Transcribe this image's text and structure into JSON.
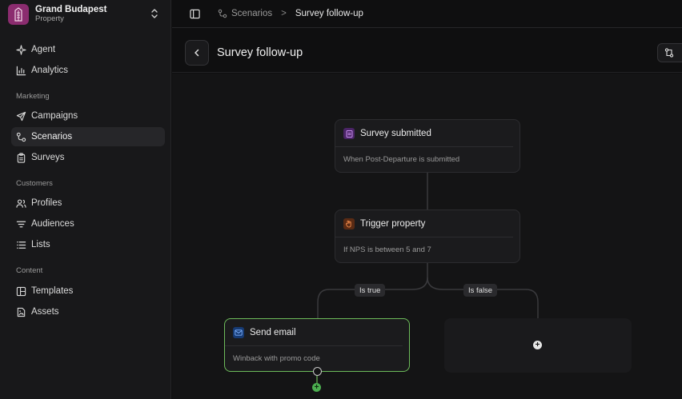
{
  "property": {
    "name": "Grand Budapest",
    "subtitle": "Property"
  },
  "nav": {
    "items_top": [
      {
        "label": "Agent",
        "icon": "sparkle-icon"
      },
      {
        "label": "Analytics",
        "icon": "bar-chart-icon"
      }
    ],
    "sections": [
      {
        "title": "Marketing",
        "items": [
          {
            "label": "Campaigns",
            "icon": "send-icon"
          },
          {
            "label": "Scenarios",
            "icon": "scenarios-icon",
            "active": true
          },
          {
            "label": "Surveys",
            "icon": "clipboard-icon"
          }
        ]
      },
      {
        "title": "Customers",
        "items": [
          {
            "label": "Profiles",
            "icon": "users-icon"
          },
          {
            "label": "Audiences",
            "icon": "filter-icon"
          },
          {
            "label": "Lists",
            "icon": "list-icon"
          }
        ]
      },
      {
        "title": "Content",
        "items": [
          {
            "label": "Templates",
            "icon": "templates-icon"
          },
          {
            "label": "Assets",
            "icon": "image-file-icon"
          }
        ]
      }
    ]
  },
  "breadcrumb": {
    "parent": "Scenarios",
    "separator": ">",
    "current": "Survey follow-up"
  },
  "header": {
    "title": "Survey follow-up"
  },
  "flow": {
    "trigger": {
      "title": "Survey submitted",
      "description": "When Post-Departure is submitted",
      "icon_color": "#7b3aa8"
    },
    "condition": {
      "title": "Trigger property",
      "description": "If NPS is between 5 and 7",
      "icon_color": "#c4581f"
    },
    "branches": {
      "true_label": "Is true",
      "false_label": "Is false"
    },
    "action": {
      "title": "Send email",
      "description": "Winback with promo code",
      "icon_color": "#2b6fd6",
      "border_color": "#6dbb5a"
    },
    "add_symbol": "+"
  },
  "colors": {
    "accent_green": "#4caf50",
    "brand": "#8b2c6f"
  }
}
